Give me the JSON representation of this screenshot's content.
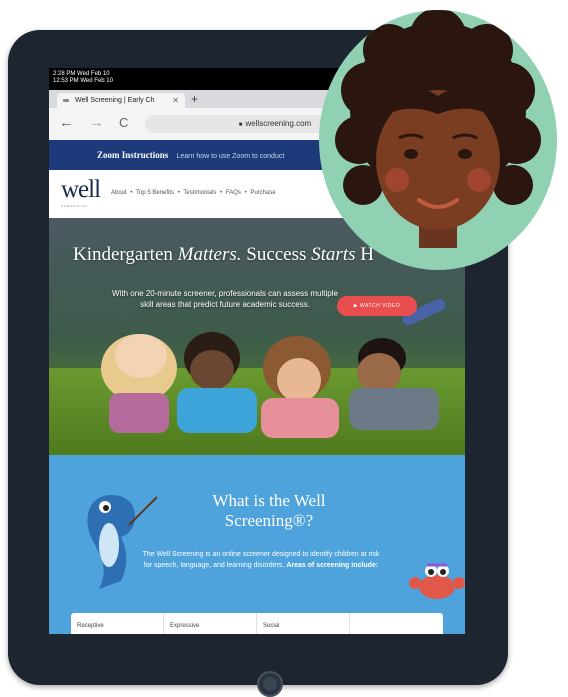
{
  "status": {
    "time_line1": "2:28 PM  Wed Feb 10",
    "time_line2": "12:53 PM  Wed Feb 10"
  },
  "browser": {
    "tab_title": "Well Screening | Early Ch",
    "tab_close": "✕",
    "new_tab": "+",
    "back": "←",
    "forward": "→",
    "reload": "C",
    "url": "wellscreening.com",
    "lock": "🔒"
  },
  "zoom_banner": {
    "title": "Zoom Instructions",
    "text": "Learn how to use Zoom to conduct"
  },
  "site_nav": {
    "logo": "well",
    "logo_sub": "SCREENING",
    "links": [
      "About",
      "Top 5 Benefits",
      "Testimonials",
      "FAQs",
      "Purchase"
    ],
    "separator": "•"
  },
  "hero": {
    "title_part1": "Kindergarten ",
    "title_part2": "Matters.",
    "title_part3": " Success ",
    "title_part4": "Starts",
    "title_part5": " H",
    "text": "With one 20-minute screener, professionals can assess multiple skill areas that predict future academic success.",
    "watch_button": "▶ WATCH VIDEO"
  },
  "about": {
    "title": "What is the Well Screening®?",
    "text": "The Well Screening is an online screener designed to identify children at risk for speech, language, and learning disorders.",
    "text_bold": "Areas of screening include:",
    "cards": [
      "Receptive",
      "Expressive",
      "Social",
      ""
    ]
  },
  "colors": {
    "nav_blue": "#1d3a7a",
    "sky_blue": "#4fa3dc",
    "watch_red": "#e94e4e",
    "avatar_bg": "#8fd1b2"
  },
  "icons": [
    "lock-icon",
    "dolphin-illustration",
    "crab-illustration",
    "avatar-illustration"
  ]
}
